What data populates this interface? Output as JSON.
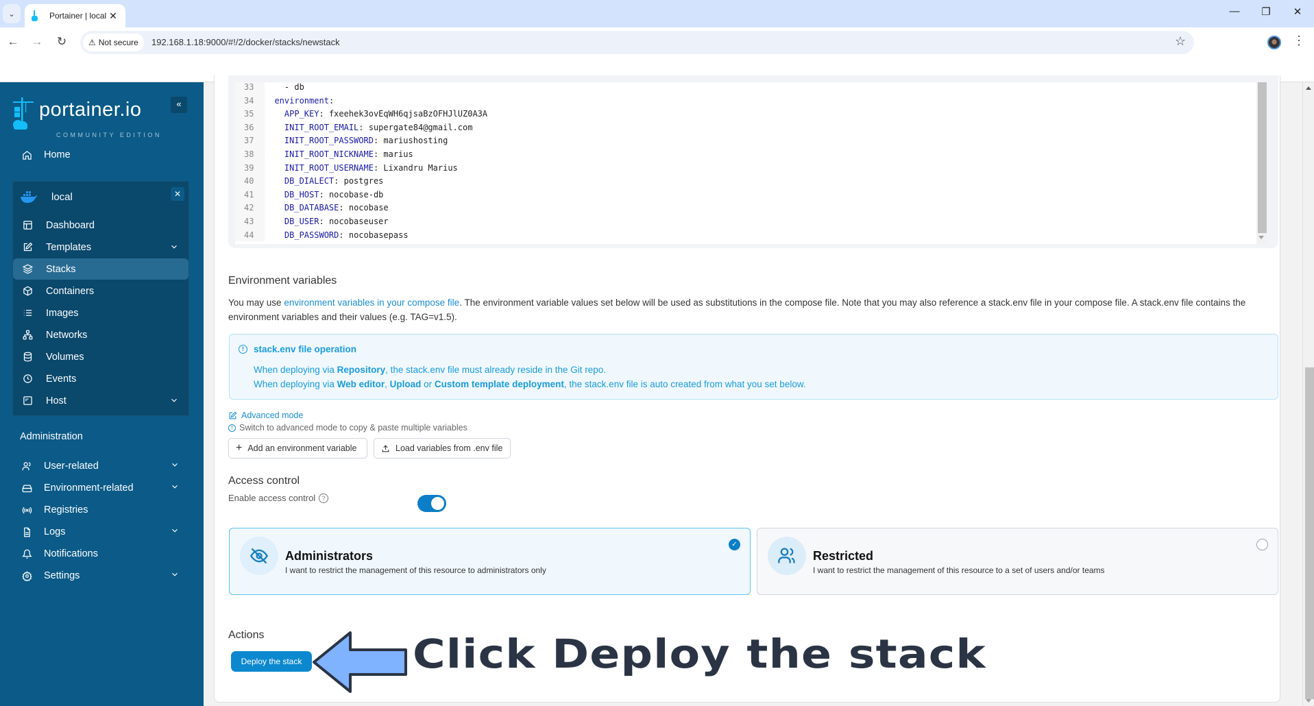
{
  "browser": {
    "tab_title": "Portainer | local",
    "tab_close": "✕",
    "tab_list": "⌄",
    "not_secure_label": "Not secure",
    "url": "192.168.1.18:9000/#!/2/docker/stacks/newstack",
    "window_controls": {
      "minimize": "—",
      "restore": "❐",
      "close": "✕"
    },
    "nav": {
      "back": "←",
      "forward": "→",
      "reload": "↻"
    },
    "star": "☆",
    "kebab": "⋮"
  },
  "sidebar": {
    "logo_text": "portainer.io",
    "logo_sub": "COMMUNITY EDITION",
    "collapse": "«",
    "home_label": "Home",
    "environment": {
      "name": "local",
      "close": "✕",
      "items": [
        {
          "label": "Dashboard",
          "icon": "layout-icon",
          "chevron": false,
          "active": false
        },
        {
          "label": "Templates",
          "icon": "edit-icon",
          "chevron": true,
          "active": false
        },
        {
          "label": "Stacks",
          "icon": "layers-icon",
          "chevron": false,
          "active": true
        },
        {
          "label": "Containers",
          "icon": "box-icon",
          "chevron": false,
          "active": false
        },
        {
          "label": "Images",
          "icon": "list-icon",
          "chevron": false,
          "active": false
        },
        {
          "label": "Networks",
          "icon": "network-icon",
          "chevron": false,
          "active": false
        },
        {
          "label": "Volumes",
          "icon": "database-icon",
          "chevron": false,
          "active": false
        },
        {
          "label": "Events",
          "icon": "clock-icon",
          "chevron": false,
          "active": false
        },
        {
          "label": "Host",
          "icon": "host-icon",
          "chevron": true,
          "active": false
        }
      ]
    },
    "admin_title": "Administration",
    "admin_items": [
      {
        "label": "User-related",
        "icon": "users-icon",
        "chevron": true
      },
      {
        "label": "Environment-related",
        "icon": "hard-drive-icon",
        "chevron": true
      },
      {
        "label": "Registries",
        "icon": "radio-icon",
        "chevron": false
      },
      {
        "label": "Logs",
        "icon": "file-text-icon",
        "chevron": true
      },
      {
        "label": "Notifications",
        "icon": "bell-icon",
        "chevron": false
      },
      {
        "label": "Settings",
        "icon": "gear-icon",
        "chevron": true
      }
    ]
  },
  "editor": {
    "lines": [
      {
        "n": "33",
        "indent": "    ",
        "key": "",
        "sep": "- ",
        "val": "db",
        "plain": true
      },
      {
        "n": "34",
        "indent": "  ",
        "key": "environment",
        "sep": ":",
        "val": ""
      },
      {
        "n": "35",
        "indent": "    ",
        "key": "APP_KEY",
        "sep": ": ",
        "val": "fxeehek3ovEqWH6qjsaBzOFHJlUZ0A3A"
      },
      {
        "n": "36",
        "indent": "    ",
        "key": "INIT_ROOT_EMAIL",
        "sep": ": ",
        "val": "supergate84@gmail.com"
      },
      {
        "n": "37",
        "indent": "    ",
        "key": "INIT_ROOT_PASSWORD",
        "sep": ": ",
        "val": "mariushosting"
      },
      {
        "n": "38",
        "indent": "    ",
        "key": "INIT_ROOT_NICKNAME",
        "sep": ": ",
        "val": "marius"
      },
      {
        "n": "39",
        "indent": "    ",
        "key": "INIT_ROOT_USERNAME",
        "sep": ": ",
        "val": "Lixandru Marius"
      },
      {
        "n": "40",
        "indent": "    ",
        "key": "DB_DIALECT",
        "sep": ": ",
        "val": "postgres"
      },
      {
        "n": "41",
        "indent": "    ",
        "key": "DB_HOST",
        "sep": ": ",
        "val": "nocobase-db"
      },
      {
        "n": "42",
        "indent": "    ",
        "key": "DB_DATABASE",
        "sep": ": ",
        "val": "nocobase"
      },
      {
        "n": "43",
        "indent": "    ",
        "key": "DB_USER",
        "sep": ": ",
        "val": "nocobaseuser"
      },
      {
        "n": "44",
        "indent": "    ",
        "key": "DB_PASSWORD",
        "sep": ": ",
        "val": "nocobasepass"
      }
    ]
  },
  "env_vars": {
    "title": "Environment variables",
    "desc_prefix": "You may use ",
    "desc_link": "environment variables in your compose file",
    "desc_suffix": ". The environment variable values set below will be used as substitutions in the compose file. Note that you may also reference a stack.env file in your compose file. A stack.env file contains the environment variables and their values (e.g. TAG=v1.5).",
    "info": {
      "title": "stack.env file operation",
      "line1_a": "When deploying via ",
      "line1_b": "Repository",
      "line1_c": ", the stack.env file must already reside in the Git repo.",
      "line2_a": "When deploying via ",
      "line2_b": "Web editor",
      "line2_c": ", ",
      "line2_d": "Upload",
      "line2_e": " or ",
      "line2_f": "Custom template deployment",
      "line2_g": ", the stack.env file is auto created from what you set below."
    },
    "advanced_mode": "Advanced mode",
    "advanced_hint": "Switch to advanced mode to copy & paste multiple variables",
    "add_button": "Add an environment variable",
    "load_button": "Load variables from .env file"
  },
  "access_control": {
    "title": "Access control",
    "enable_label": "Enable access control",
    "enabled": true,
    "options": [
      {
        "title": "Administrators",
        "desc": "I want to restrict the management of this resource to administrators only",
        "selected": true
      },
      {
        "title": "Restricted",
        "desc": "I want to restrict the management of this resource to a set of users and/or teams",
        "selected": false
      }
    ]
  },
  "actions": {
    "title": "Actions",
    "deploy_button": "Deploy the stack"
  },
  "annotation": {
    "text": "Click Deploy the stack",
    "arrow_color": "#7fb2ff"
  },
  "colors": {
    "sidebar": "#0b5a87",
    "sidebar_panel": "#0a486c",
    "accent": "#0c88cf",
    "info": "#1a9bdb"
  }
}
